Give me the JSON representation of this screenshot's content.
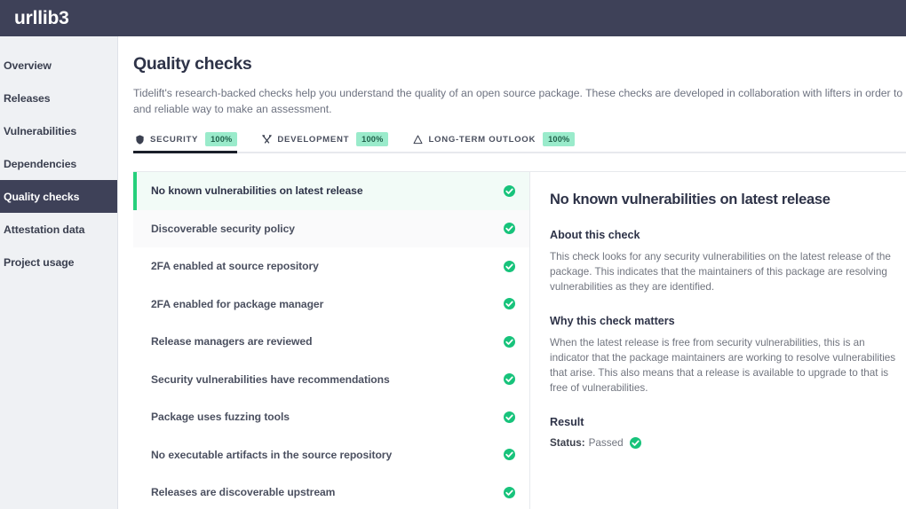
{
  "header": {
    "title": "urllib3"
  },
  "sidebar": {
    "items": [
      {
        "label": "Overview",
        "active": false
      },
      {
        "label": "Releases",
        "active": false
      },
      {
        "label": "Vulnerabilities",
        "active": false
      },
      {
        "label": "Dependencies",
        "active": false
      },
      {
        "label": "Quality checks",
        "active": true
      },
      {
        "label": "Attestation data",
        "active": false
      },
      {
        "label": "Project usage",
        "active": false
      }
    ]
  },
  "main": {
    "title": "Quality checks",
    "description": "Tidelift's research-backed checks help you understand the quality of an open source package. These checks are developed in collaboration with lifters in order to provide a practical, fast, and reliable way to make an assessment.",
    "tabs": [
      {
        "label": "SECURITY",
        "badge": "100%",
        "icon": "shield-icon",
        "active": true
      },
      {
        "label": "DEVELOPMENT",
        "badge": "100%",
        "icon": "tools-icon",
        "active": false
      },
      {
        "label": "LONG-TERM OUTLOOK",
        "badge": "100%",
        "icon": "telescope-icon",
        "active": false
      }
    ]
  },
  "checks": [
    {
      "label": "No known vulnerabilities on latest release",
      "status": "passed",
      "active": true
    },
    {
      "label": "Discoverable security policy",
      "status": "passed",
      "active": false
    },
    {
      "label": "2FA enabled at source repository",
      "status": "passed",
      "active": false
    },
    {
      "label": "2FA enabled for package manager",
      "status": "passed",
      "active": false
    },
    {
      "label": "Release managers are reviewed",
      "status": "passed",
      "active": false
    },
    {
      "label": "Security vulnerabilities have recommendations",
      "status": "passed",
      "active": false
    },
    {
      "label": "Package uses fuzzing tools",
      "status": "passed",
      "active": false
    },
    {
      "label": "No executable artifacts in the source repository",
      "status": "passed",
      "active": false
    },
    {
      "label": "Releases are discoverable upstream",
      "status": "passed",
      "active": false
    }
  ],
  "detail": {
    "title": "No known vulnerabilities on latest release",
    "about_heading": "About this check",
    "about_text": "This check looks for any security vulnerabilities on the latest release of the package. This indicates that the maintainers of this package are resolving vulnerabilities as they are identified.",
    "why_heading": "Why this check matters",
    "why_text": "When the latest release is free from security vulnerabilities, this is an indicator that the package maintainers are working to resolve vulnerabilities that arise. This also means that a release is available to upgrade to that is free of vulnerabilities.",
    "result_heading": "Result",
    "status_label": "Status:",
    "status_value": "Passed"
  },
  "colors": {
    "header_bg": "#3e4158",
    "sidebar_bg": "#eff1f4",
    "accent_green": "#17c37b",
    "badge_bg": "#9aebcb",
    "active_row_bg": "#f2fbf7",
    "active_row_border": "#26d07c"
  }
}
